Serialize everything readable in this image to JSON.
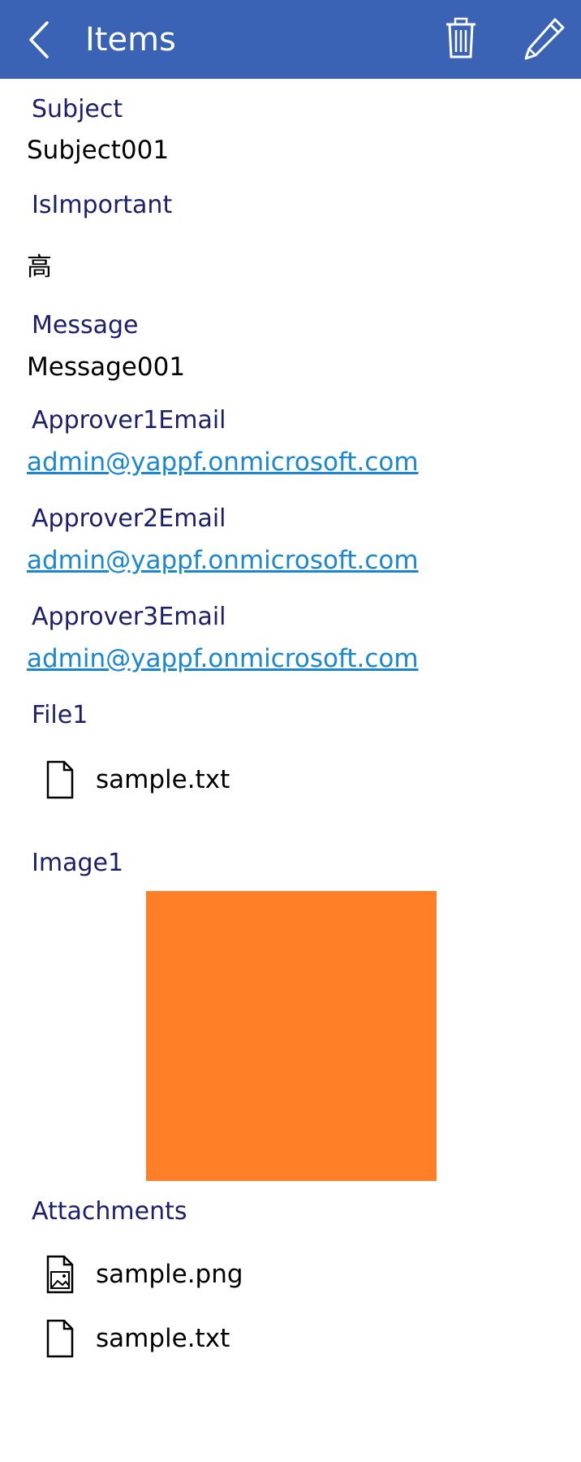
{
  "header": {
    "title": "Items",
    "background_color": "#3a63b6",
    "back_icon": "chevron-left-icon",
    "delete_icon": "trash-icon",
    "edit_icon": "pencil-icon"
  },
  "fields": {
    "subject": {
      "label": "Subject",
      "value": "Subject001"
    },
    "is_important": {
      "label": "IsImportant",
      "value": "高"
    },
    "message": {
      "label": "Message",
      "value": "Message001"
    },
    "approver1": {
      "label": "Approver1Email",
      "value": "admin@yappf.onmicrosoft.com"
    },
    "approver2": {
      "label": "Approver2Email",
      "value": "admin@yappf.onmicrosoft.com"
    },
    "approver3": {
      "label": "Approver3Email",
      "value": "admin@yappf.onmicrosoft.com"
    },
    "file1": {
      "label": "File1",
      "file_name": "sample.txt",
      "icon": "document-icon"
    },
    "image1": {
      "label": "Image1",
      "fill_color": "#ff7f27"
    },
    "attachments": {
      "label": "Attachments",
      "items": [
        {
          "name": "sample.png",
          "icon": "image-file-icon"
        },
        {
          "name": "sample.txt",
          "icon": "document-icon"
        }
      ]
    }
  },
  "colors": {
    "label": "#1c1f6e",
    "link": "#1a87d4",
    "value": "#000000"
  }
}
